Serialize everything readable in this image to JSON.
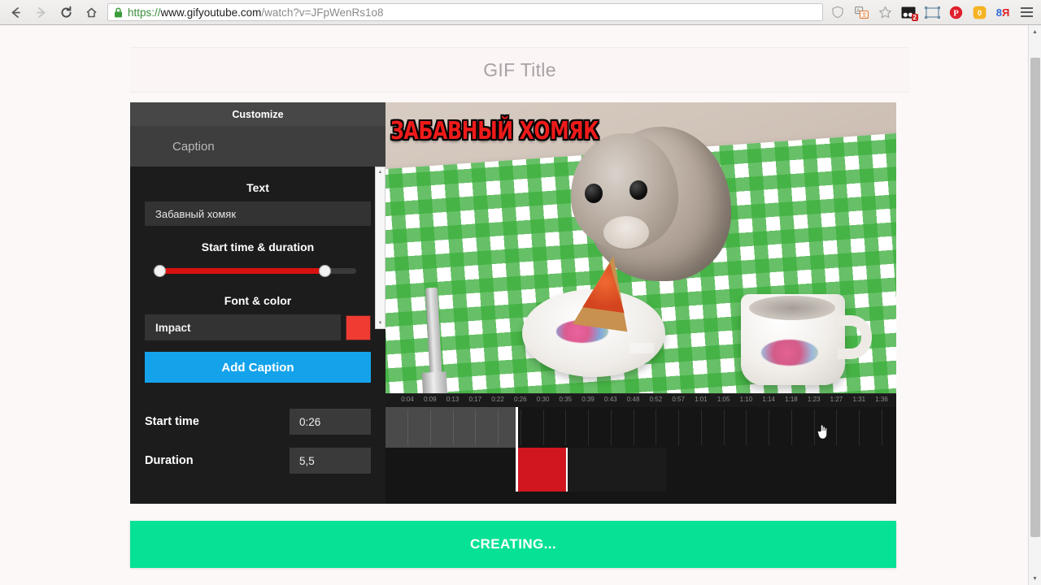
{
  "browser": {
    "nav": {
      "back_label": "back-arrow",
      "forward_label": "forward-arrow",
      "reload_label": "reload",
      "home_label": "home"
    },
    "url": {
      "scheme": "https://",
      "host": "www.gifyoutube.com",
      "path": "/watch?v=JFpWenRs1o8",
      "full": "https://www.gifyoutube.com/watch?v=JFpWenRs1o8",
      "secure_icon": "lock-icon"
    },
    "extensions": [
      {
        "name": "shield-icon",
        "glyph": "⛨",
        "badge": ""
      },
      {
        "name": "translate-icon",
        "glyph": "語",
        "badge": ""
      },
      {
        "name": "bookmark-star-icon",
        "glyph": "☆",
        "badge": ""
      },
      {
        "name": "screen-capture-icon",
        "glyph": "",
        "badge": "2"
      },
      {
        "name": "screenshot-frame-icon",
        "glyph": "",
        "badge": ""
      },
      {
        "name": "pinterest-icon",
        "glyph": "P",
        "badge": ""
      },
      {
        "name": "notification-icon",
        "glyph": "0",
        "badge": ""
      },
      {
        "name": "yandex-icon",
        "glyph": "8Я",
        "badge": ""
      }
    ],
    "menu_label": "chrome-menu"
  },
  "page": {
    "gif_title_placeholder": "GIF Title"
  },
  "sidebar": {
    "tab_customize": "Customize",
    "tab_caption": "Caption",
    "text_label": "Text",
    "text_value": "Забавный хомяк",
    "start_duration_label": "Start time & duration",
    "font_color_label": "Font & color",
    "font_value": "Impact",
    "color_value": "#f03b32",
    "add_caption_label": "Add Caption",
    "start_time_label": "Start time",
    "start_time_value": "0:26",
    "duration_label": "Duration",
    "duration_value": "5,5"
  },
  "video": {
    "caption_overlay": "ЗАБАВНЫЙ ХОМЯК",
    "caption_color": "#ee1b1b",
    "scene_description": "hamster eating a slice of pizza on a green checkered placemat with fork, plate and teacup"
  },
  "timeline": {
    "ticks": [
      "0:04",
      "0:09",
      "0:13",
      "0:17",
      "0:22",
      "0:26",
      "0:30",
      "0:35",
      "0:39",
      "0:43",
      "0:48",
      "0:52",
      "0:57",
      "1:01",
      "1:05",
      "1:10",
      "1:14",
      "1:18",
      "1:23",
      "1:27",
      "1:31",
      "1:36"
    ],
    "playhead_time": "0:26",
    "selection_start": "0:26",
    "selection_duration": "5,5"
  },
  "footer": {
    "create_label": "CREATING..."
  }
}
